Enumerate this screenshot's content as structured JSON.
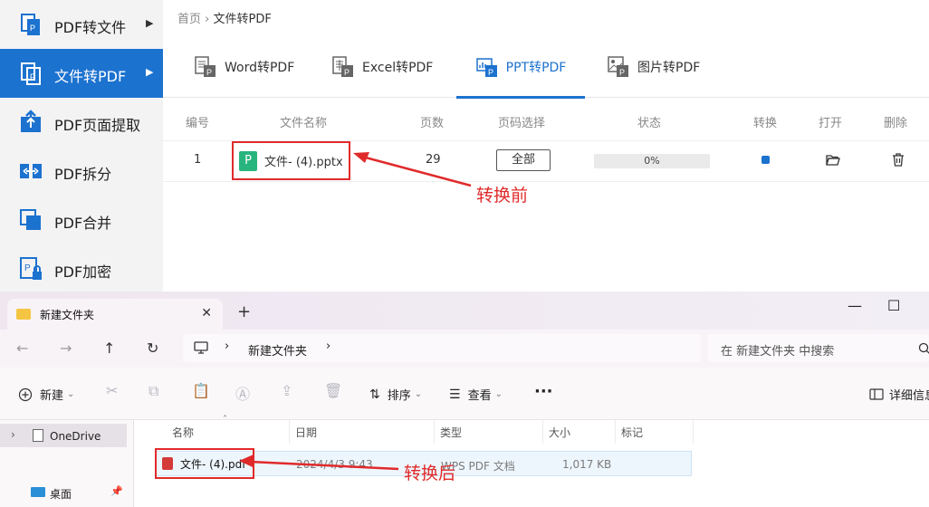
{
  "sidebar": {
    "items": [
      {
        "label": "PDF转文件",
        "icon": "pdf-to-file-icon",
        "arrow": "▶"
      },
      {
        "label": "文件转PDF",
        "icon": "file-to-pdf-icon",
        "arrow": "▶",
        "active": true
      },
      {
        "label": "PDF页面提取",
        "icon": "pdf-extract-icon"
      },
      {
        "label": "PDF拆分",
        "icon": "pdf-split-icon"
      },
      {
        "label": "PDF合并",
        "icon": "pdf-merge-icon"
      },
      {
        "label": "PDF加密",
        "icon": "pdf-encrypt-icon"
      }
    ]
  },
  "breadcrumb": {
    "home": "首页",
    "sep": "›",
    "current": "文件转PDF"
  },
  "tabs": [
    {
      "label": "Word转PDF",
      "icon": "word-doc-icon"
    },
    {
      "label": "Excel转PDF",
      "icon": "excel-doc-icon"
    },
    {
      "label": "PPT转PDF",
      "icon": "ppt-doc-icon",
      "active": true
    },
    {
      "label": "图片转PDF",
      "icon": "image-doc-icon"
    }
  ],
  "table": {
    "headers": [
      "编号",
      "文件名称",
      "页数",
      "页码选择",
      "状态",
      "转换",
      "打开",
      "删除"
    ],
    "row": {
      "index": "1",
      "badge": "P",
      "filename": "文件- (4).pptx",
      "pages": "29",
      "page_select": "全部",
      "progress": "0%",
      "progress_fraction": 0
    }
  },
  "annotations": {
    "before": "转换前",
    "after": "转换后"
  },
  "colors": {
    "accent": "#1c72cf",
    "annotation_red": "#e02a2a",
    "ppt_green": "#28b47d"
  },
  "explorer": {
    "tab_title": "新建文件夹",
    "tab_close": "✕",
    "new_tab": "+",
    "window": {
      "minimize": "—",
      "maximize": "☐"
    },
    "nav": {
      "back": "←",
      "forward": "→",
      "up": "↑",
      "refresh": "↻"
    },
    "address": {
      "chevron": "›",
      "folder": "新建文件夹"
    },
    "search_placeholder": "在 新建文件夹 中搜索",
    "commands": {
      "new": "新建",
      "sort": "排序",
      "view": "查看",
      "more": "···",
      "details": "详细信息"
    },
    "nav_pane": {
      "onedrive": "OneDrive",
      "desktop": "桌面"
    },
    "columns": [
      "名称",
      "日期",
      "类型",
      "大小",
      "标记"
    ],
    "file": {
      "name": "文件- (4).pdf",
      "date": "2024/4/3 9:43",
      "type": "WPS PDF 文档",
      "size": "1,017 KB"
    }
  }
}
